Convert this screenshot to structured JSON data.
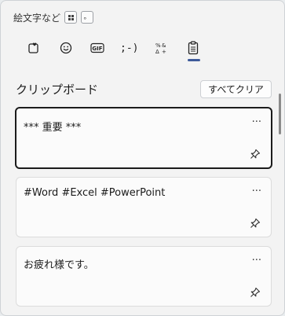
{
  "window": {
    "title": "絵文字など",
    "dot_label": "。"
  },
  "tabs": [
    {
      "name": "heart-emoji-icon",
      "active": false
    },
    {
      "name": "smiley-icon",
      "active": false
    },
    {
      "name": "gif-icon",
      "label": "GIF",
      "active": false
    },
    {
      "name": "kaomoji-icon",
      "label": ";-)",
      "active": false
    },
    {
      "name": "symbols-icon",
      "active": false
    },
    {
      "name": "clipboard-icon",
      "active": true
    }
  ],
  "clipboard": {
    "heading": "クリップボード",
    "clear_all_label": "すべてクリア",
    "items": [
      {
        "text": "*** 重要 ***",
        "selected": true,
        "more": "···"
      },
      {
        "text": "#Word #Excel #PowerPoint",
        "selected": false,
        "more": "···"
      },
      {
        "text": "お疲れ様です。",
        "selected": false,
        "more": "···"
      }
    ]
  },
  "colors": {
    "accent": "#3d5a9a",
    "background": "#f3f3f3",
    "card": "#fbfbfb"
  }
}
